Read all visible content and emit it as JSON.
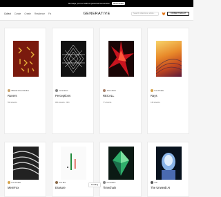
{
  "banner": {
    "text": "Remaps your art with AI-powered Generative",
    "button": "READ MORE"
  },
  "nav": {
    "tabs": [
      "Collect",
      "Curate",
      "Create",
      "Residence",
      "Fix"
    ],
    "logo": "GENERATIVE",
    "search_placeholder": "Search collections, artists...",
    "connect": "CONNECT WALLET"
  },
  "cards": [
    {
      "title": "Runers",
      "artist": "Mikado Ghoul Studios",
      "editions": "593 artworks"
    },
    {
      "title": "Perceptions",
      "artist": "Generation",
      "editions": "984 artworks  ·  NFC"
    },
    {
      "title": "RECALL",
      "artist": "Jason Mohr",
      "editions": "77 artworks"
    },
    {
      "title": "Rays",
      "artist": "Fuxi Pivalla",
      "editions": "138 artworks"
    },
    {
      "title": "MemFox",
      "artist": "Fuxi Pivalla",
      "editions": ""
    },
    {
      "title": "Erasure",
      "artist": "Aris Brix",
      "editions": ""
    },
    {
      "title": "Timechain",
      "artist": "Generation",
      "editions": ""
    },
    {
      "title": "The Unwealt AI",
      "artist": "CSI",
      "editions": ""
    }
  ],
  "tooltip": "Trending",
  "colors": {
    "banner": "#000000",
    "background": "#f5f5f5",
    "card": "#ffffff"
  }
}
